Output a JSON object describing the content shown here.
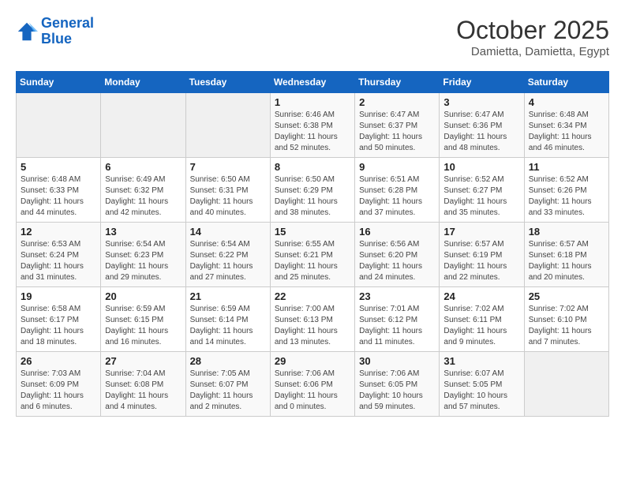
{
  "header": {
    "logo_line1": "General",
    "logo_line2": "Blue",
    "month": "October 2025",
    "location": "Damietta, Damietta, Egypt"
  },
  "days_of_week": [
    "Sunday",
    "Monday",
    "Tuesday",
    "Wednesday",
    "Thursday",
    "Friday",
    "Saturday"
  ],
  "weeks": [
    [
      {
        "day": "",
        "info": ""
      },
      {
        "day": "",
        "info": ""
      },
      {
        "day": "",
        "info": ""
      },
      {
        "day": "1",
        "info": "Sunrise: 6:46 AM\nSunset: 6:38 PM\nDaylight: 11 hours\nand 52 minutes."
      },
      {
        "day": "2",
        "info": "Sunrise: 6:47 AM\nSunset: 6:37 PM\nDaylight: 11 hours\nand 50 minutes."
      },
      {
        "day": "3",
        "info": "Sunrise: 6:47 AM\nSunset: 6:36 PM\nDaylight: 11 hours\nand 48 minutes."
      },
      {
        "day": "4",
        "info": "Sunrise: 6:48 AM\nSunset: 6:34 PM\nDaylight: 11 hours\nand 46 minutes."
      }
    ],
    [
      {
        "day": "5",
        "info": "Sunrise: 6:48 AM\nSunset: 6:33 PM\nDaylight: 11 hours\nand 44 minutes."
      },
      {
        "day": "6",
        "info": "Sunrise: 6:49 AM\nSunset: 6:32 PM\nDaylight: 11 hours\nand 42 minutes."
      },
      {
        "day": "7",
        "info": "Sunrise: 6:50 AM\nSunset: 6:31 PM\nDaylight: 11 hours\nand 40 minutes."
      },
      {
        "day": "8",
        "info": "Sunrise: 6:50 AM\nSunset: 6:29 PM\nDaylight: 11 hours\nand 38 minutes."
      },
      {
        "day": "9",
        "info": "Sunrise: 6:51 AM\nSunset: 6:28 PM\nDaylight: 11 hours\nand 37 minutes."
      },
      {
        "day": "10",
        "info": "Sunrise: 6:52 AM\nSunset: 6:27 PM\nDaylight: 11 hours\nand 35 minutes."
      },
      {
        "day": "11",
        "info": "Sunrise: 6:52 AM\nSunset: 6:26 PM\nDaylight: 11 hours\nand 33 minutes."
      }
    ],
    [
      {
        "day": "12",
        "info": "Sunrise: 6:53 AM\nSunset: 6:24 PM\nDaylight: 11 hours\nand 31 minutes."
      },
      {
        "day": "13",
        "info": "Sunrise: 6:54 AM\nSunset: 6:23 PM\nDaylight: 11 hours\nand 29 minutes."
      },
      {
        "day": "14",
        "info": "Sunrise: 6:54 AM\nSunset: 6:22 PM\nDaylight: 11 hours\nand 27 minutes."
      },
      {
        "day": "15",
        "info": "Sunrise: 6:55 AM\nSunset: 6:21 PM\nDaylight: 11 hours\nand 25 minutes."
      },
      {
        "day": "16",
        "info": "Sunrise: 6:56 AM\nSunset: 6:20 PM\nDaylight: 11 hours\nand 24 minutes."
      },
      {
        "day": "17",
        "info": "Sunrise: 6:57 AM\nSunset: 6:19 PM\nDaylight: 11 hours\nand 22 minutes."
      },
      {
        "day": "18",
        "info": "Sunrise: 6:57 AM\nSunset: 6:18 PM\nDaylight: 11 hours\nand 20 minutes."
      }
    ],
    [
      {
        "day": "19",
        "info": "Sunrise: 6:58 AM\nSunset: 6:17 PM\nDaylight: 11 hours\nand 18 minutes."
      },
      {
        "day": "20",
        "info": "Sunrise: 6:59 AM\nSunset: 6:15 PM\nDaylight: 11 hours\nand 16 minutes."
      },
      {
        "day": "21",
        "info": "Sunrise: 6:59 AM\nSunset: 6:14 PM\nDaylight: 11 hours\nand 14 minutes."
      },
      {
        "day": "22",
        "info": "Sunrise: 7:00 AM\nSunset: 6:13 PM\nDaylight: 11 hours\nand 13 minutes."
      },
      {
        "day": "23",
        "info": "Sunrise: 7:01 AM\nSunset: 6:12 PM\nDaylight: 11 hours\nand 11 minutes."
      },
      {
        "day": "24",
        "info": "Sunrise: 7:02 AM\nSunset: 6:11 PM\nDaylight: 11 hours\nand 9 minutes."
      },
      {
        "day": "25",
        "info": "Sunrise: 7:02 AM\nSunset: 6:10 PM\nDaylight: 11 hours\nand 7 minutes."
      }
    ],
    [
      {
        "day": "26",
        "info": "Sunrise: 7:03 AM\nSunset: 6:09 PM\nDaylight: 11 hours\nand 6 minutes."
      },
      {
        "day": "27",
        "info": "Sunrise: 7:04 AM\nSunset: 6:08 PM\nDaylight: 11 hours\nand 4 minutes."
      },
      {
        "day": "28",
        "info": "Sunrise: 7:05 AM\nSunset: 6:07 PM\nDaylight: 11 hours\nand 2 minutes."
      },
      {
        "day": "29",
        "info": "Sunrise: 7:06 AM\nSunset: 6:06 PM\nDaylight: 11 hours\nand 0 minutes."
      },
      {
        "day": "30",
        "info": "Sunrise: 7:06 AM\nSunset: 6:05 PM\nDaylight: 10 hours\nand 59 minutes."
      },
      {
        "day": "31",
        "info": "Sunrise: 6:07 AM\nSunset: 5:05 PM\nDaylight: 10 hours\nand 57 minutes."
      },
      {
        "day": "",
        "info": ""
      }
    ]
  ]
}
